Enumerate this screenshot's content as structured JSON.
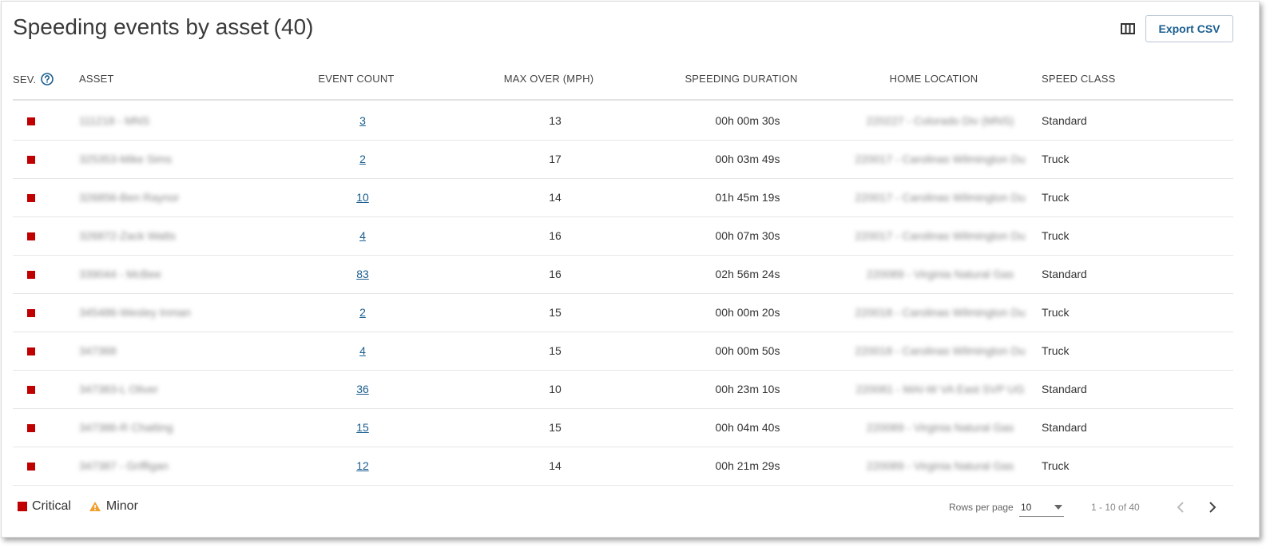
{
  "header": {
    "title": "Speeding events by asset",
    "count": "(40)",
    "export_label": "Export CSV"
  },
  "columns": {
    "sev": "SEV.",
    "asset": "ASSET",
    "event_count": "EVENT COUNT",
    "max_over": "MAX OVER (MPH)",
    "duration": "SPEEDING DURATION",
    "home": "HOME LOCATION",
    "speed_class": "SPEED CLASS"
  },
  "rows": [
    {
      "asset": "111218 - MNS",
      "count": "3",
      "max_over": "13",
      "duration": "00h 00m 30s",
      "home": "220227 - Colorado Div (MNS)",
      "speed_class": "Standard"
    },
    {
      "asset": "325353-Mike Sims",
      "count": "2",
      "max_over": "17",
      "duration": "00h 03m 49s",
      "home": "220017 - Carolinas Wilmington Du",
      "speed_class": "Truck"
    },
    {
      "asset": "326856-Ben Raynor",
      "count": "10",
      "max_over": "14",
      "duration": "01h 45m 19s",
      "home": "220017 - Carolinas Wilmington Du",
      "speed_class": "Truck"
    },
    {
      "asset": "326872-Zack Watts",
      "count": "4",
      "max_over": "16",
      "duration": "00h 07m 30s",
      "home": "220017 - Carolinas Wilmington Du",
      "speed_class": "Truck"
    },
    {
      "asset": "339044 - McBee",
      "count": "83",
      "max_over": "16",
      "duration": "02h 56m 24s",
      "home": "220089 - Virginia Natural Gas",
      "speed_class": "Standard"
    },
    {
      "asset": "345486-Wesley Inman",
      "count": "2",
      "max_over": "15",
      "duration": "00h 00m 20s",
      "home": "220018 - Carolinas Wilmington Du",
      "speed_class": "Truck"
    },
    {
      "asset": "347368",
      "count": "4",
      "max_over": "15",
      "duration": "00h 00m 50s",
      "home": "220018 - Carolinas Wilmington Du",
      "speed_class": "Truck"
    },
    {
      "asset": "347383-L Oliver",
      "count": "36",
      "max_over": "10",
      "duration": "00h 23m 10s",
      "home": "220081 - MAI-W VA East SVP UG",
      "speed_class": "Standard"
    },
    {
      "asset": "347386-R Chatting",
      "count": "15",
      "max_over": "15",
      "duration": "00h 04m 40s",
      "home": "220089 - Virginia Natural Gas",
      "speed_class": "Standard"
    },
    {
      "asset": "347387 - Griffigan",
      "count": "12",
      "max_over": "14",
      "duration": "00h 21m 29s",
      "home": "220089 - Virginia Natural Gas",
      "speed_class": "Truck"
    }
  ],
  "legend": {
    "critical": "Critical",
    "minor": "Minor"
  },
  "pagination": {
    "rows_per_page_label": "Rows per page",
    "rows_per_page_value": "10",
    "range": "1 - 10 of 40"
  },
  "colors": {
    "critical": "#c00000",
    "minor": "#f0a030",
    "link": "#1b5e8f"
  },
  "icons": {
    "columns": "columns-icon",
    "help": "help-circle-icon",
    "prev": "chevron-left-icon",
    "next": "chevron-right-icon"
  }
}
